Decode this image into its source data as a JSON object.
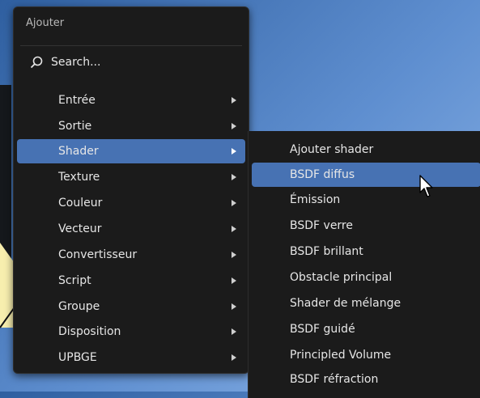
{
  "menu": {
    "title": "Ajouter",
    "search_label": "Search...",
    "items": [
      {
        "label": "Entrée"
      },
      {
        "label": "Sortie"
      },
      {
        "label": "Shader"
      },
      {
        "label": "Texture"
      },
      {
        "label": "Couleur"
      },
      {
        "label": "Vecteur"
      },
      {
        "label": "Convertisseur"
      },
      {
        "label": "Script"
      },
      {
        "label": "Groupe"
      },
      {
        "label": "Disposition"
      },
      {
        "label": "UPBGE"
      }
    ],
    "active_item": "Shader"
  },
  "submenu": {
    "items": [
      {
        "label": "Ajouter shader"
      },
      {
        "label": "BSDF diffus"
      },
      {
        "label": "Émission"
      },
      {
        "label": "BSDF verre"
      },
      {
        "label": "BSDF brillant"
      },
      {
        "label": "Obstacle principal"
      },
      {
        "label": "Shader de mélange"
      },
      {
        "label": "BSDF guidé"
      },
      {
        "label": "Principled Volume"
      },
      {
        "label": "BSDF réfraction"
      }
    ],
    "hovered_item": "BSDF diffus"
  },
  "colors": {
    "menu_bg": "#1b1b1b",
    "highlight": "#4772b3",
    "text": "#e6e6e6",
    "callout": "#f7eeae"
  },
  "icons": [
    "search-icon",
    "chevron-right-icon",
    "mouse-pointer-icon"
  ]
}
